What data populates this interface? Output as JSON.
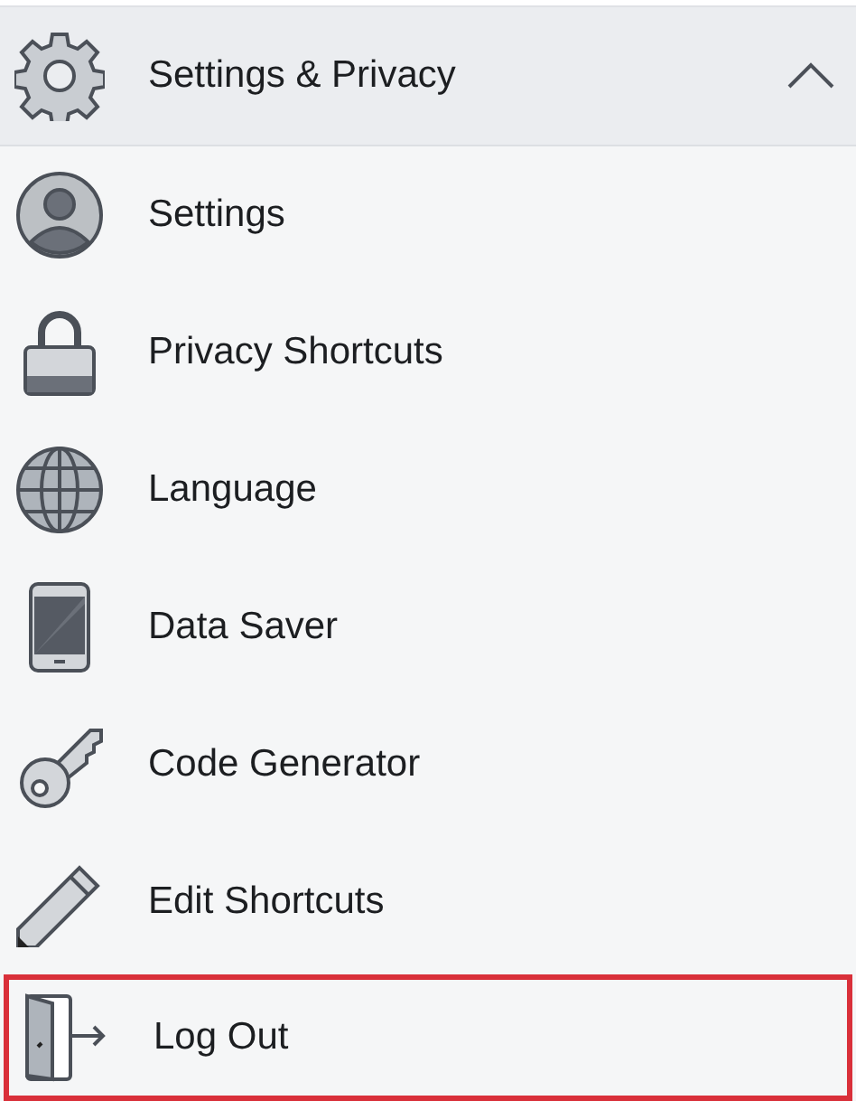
{
  "header": {
    "title": "Settings & Privacy",
    "expanded": true
  },
  "items": [
    {
      "kind": "profile",
      "label": "Settings",
      "highlighted": false
    },
    {
      "kind": "lock",
      "label": "Privacy Shortcuts",
      "highlighted": false
    },
    {
      "kind": "globe",
      "label": "Language",
      "highlighted": false
    },
    {
      "kind": "phone",
      "label": "Data Saver",
      "highlighted": false
    },
    {
      "kind": "key",
      "label": "Code Generator",
      "highlighted": false
    },
    {
      "kind": "pencil",
      "label": "Edit Shortcuts",
      "highlighted": false
    },
    {
      "kind": "logout",
      "label": "Log Out",
      "highlighted": true
    }
  ]
}
